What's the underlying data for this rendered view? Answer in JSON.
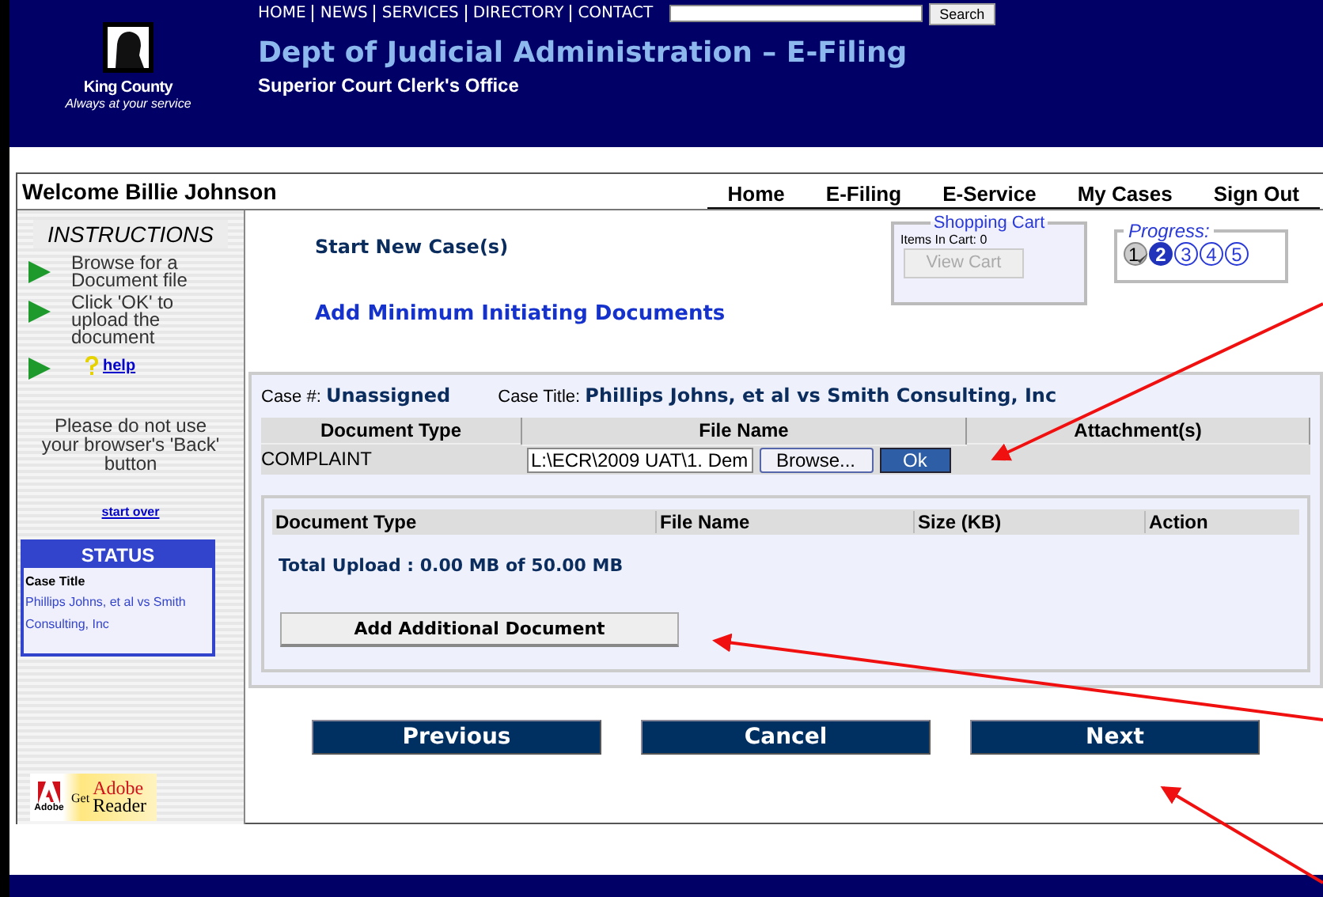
{
  "header": {
    "logo_name": "King County",
    "logo_tagline": "Always at your service",
    "top_nav": [
      "HOME",
      "NEWS",
      "SERVICES",
      "DIRECTORY",
      "CONTACT"
    ],
    "search_button": "Search",
    "title": "Dept of Judicial Administration – E-Filing",
    "subtitle": "Superior Court Clerk's Office"
  },
  "welcome": "Welcome Billie Johnson",
  "main_nav": [
    "Home",
    "E-Filing",
    "E-Service",
    "My Cases",
    "Sign Out"
  ],
  "instructions": {
    "title": "INSTRUCTIONS",
    "steps": [
      {
        "kind": "text",
        "text": "Browse for a Document file"
      },
      {
        "kind": "text",
        "text": "Click 'OK' to upload the document"
      },
      {
        "kind": "link",
        "text": "help"
      }
    ],
    "warning": "Please do not use your browser's 'Back' button",
    "start_over": "start over"
  },
  "status": {
    "title": "STATUS",
    "label": "Case Title",
    "value": "Phillips Johns, et al vs Smith Consulting, Inc"
  },
  "adobe": {
    "brand": "Adobe",
    "get": "Get",
    "product_1": "Adobe",
    "product_2": "Reader"
  },
  "page_title": "Start New Case(s)",
  "section_title": "Add Minimum Initiating Documents",
  "cart": {
    "title": "Shopping Cart",
    "items": "Items In Cart: 0",
    "button": "View Cart",
    "disabled": true
  },
  "progress": {
    "title": "Progress:",
    "steps": [
      {
        "label": "1",
        "completed": true,
        "selected": false
      },
      {
        "label": "2",
        "completed": false,
        "selected": true
      },
      {
        "label": "3",
        "completed": false,
        "selected": false
      },
      {
        "label": "4",
        "completed": false,
        "selected": false
      },
      {
        "label": "5",
        "completed": false,
        "selected": false
      }
    ]
  },
  "case": {
    "number_label": "Case #:",
    "number": "Unassigned",
    "title_label": "Case Title:",
    "title": "Phillips Johns, et al vs Smith Consulting, Inc"
  },
  "upload_table": {
    "columns": [
      "Document Type",
      "File Name",
      "Attachment(s)"
    ],
    "rows": [
      {
        "document_type": "COMPLAINT",
        "file_value": "L:\\ECR\\2009 UAT\\1. Dem",
        "browse": "Browse...",
        "ok": "Ok"
      }
    ]
  },
  "documents_table": {
    "columns": [
      "Document Type",
      "File Name",
      "Size (KB)",
      "Action"
    ],
    "total": "Total Upload : 0.00 MB of 50.00 MB",
    "add_button": "Add Additional Document"
  },
  "buttons": [
    "Previous",
    "Cancel",
    "Next"
  ]
}
